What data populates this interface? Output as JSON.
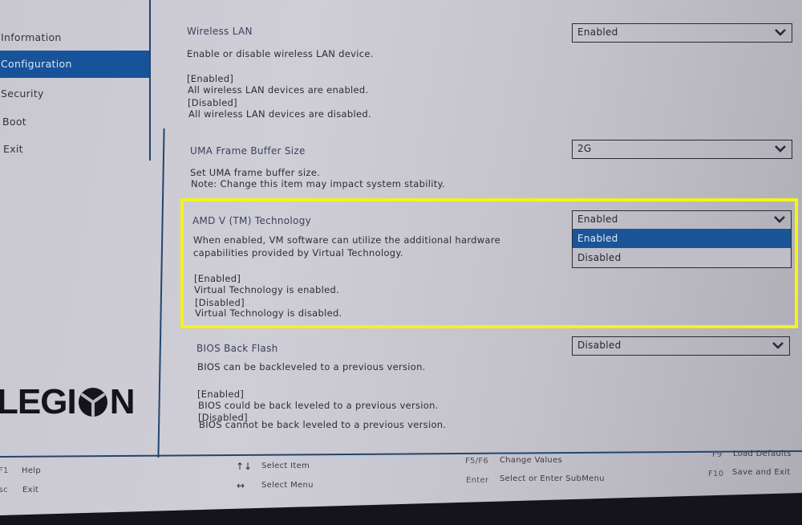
{
  "sidebar": {
    "items": [
      {
        "label": "Information",
        "active": false
      },
      {
        "label": "Configuration",
        "active": true
      },
      {
        "label": "Security",
        "active": false
      },
      {
        "label": "Boot",
        "active": false
      },
      {
        "label": "Exit",
        "active": false
      }
    ],
    "logo": {
      "prefix": "LEGI",
      "suffix": "N"
    }
  },
  "settings": {
    "wireless_lan": {
      "title": "Wireless LAN",
      "value": "Enabled",
      "description": "Enable or disable wireless LAN device.",
      "enabled_label": "[Enabled]",
      "enabled_desc": "All wireless LAN devices are enabled.",
      "disabled_label": "[Disabled]",
      "disabled_desc": "All wireless LAN devices are disabled."
    },
    "uma_frame_buffer": {
      "title": "UMA Frame Buffer Size",
      "value": "2G",
      "description": "Set UMA frame buffer size.",
      "note": "Note: Change this item may impact system stability."
    },
    "amd_v": {
      "title": "AMD V (TM) Technology",
      "value": "Enabled",
      "description_line1": "When enabled, VM software can utilize the additional hardware",
      "description_line2": "capabilities provided by Virtual Technology.",
      "enabled_label": "[Enabled]",
      "enabled_desc": "Virtual Technology is enabled.",
      "disabled_label": "[Disabled]",
      "disabled_desc": "Virtual Technology is disabled.",
      "options": [
        "Enabled",
        "Disabled"
      ],
      "highlighted_option": "Enabled"
    },
    "bios_back_flash": {
      "title": "BIOS Back Flash",
      "value": "Disabled",
      "description": "BIOS can be backleveled to a previous version.",
      "enabled_label": "[Enabled]",
      "enabled_desc": "BIOS could be back leveled to a previous version.",
      "disabled_label": "[Disabled]",
      "disabled_desc": "BIOS cannot be back leveled to a previous version."
    }
  },
  "footer": {
    "help_key": "F1",
    "help_label": "Help",
    "exit_key": "Esc",
    "exit_label": "Exit",
    "select_item_key": "↑↓",
    "select_item_label": "Select Item",
    "select_menu_key": "↔",
    "select_menu_label": "Select Menu",
    "change_key": "F5/F6",
    "change_label": "Change Values",
    "enter_key": "Enter",
    "enter_label": "Select or Enter SubMenu",
    "defaults_key": "F9",
    "defaults_label": "Load Defaults",
    "save_key": "F10",
    "save_label": "Save and Exit"
  },
  "colors": {
    "accent_blue": "#17539a",
    "highlight_yellow": "#f4f21c"
  }
}
